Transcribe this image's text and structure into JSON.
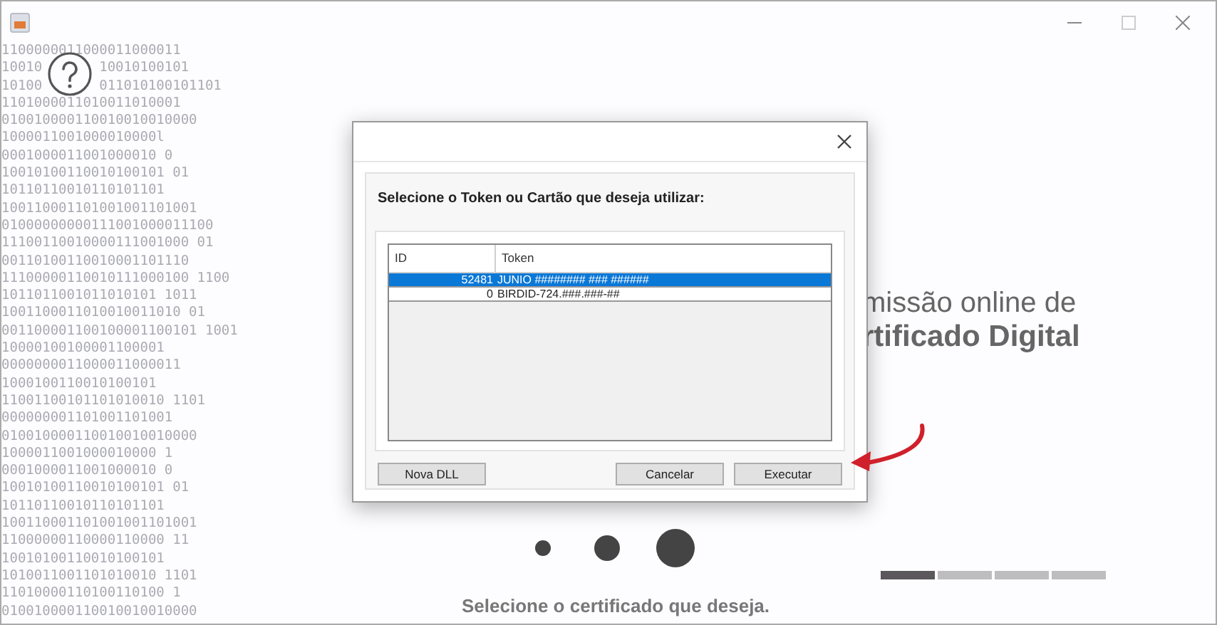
{
  "window": {
    "controls": [
      {
        "kind": "minimize"
      },
      {
        "kind": "maximize"
      },
      {
        "kind": "close"
      }
    ]
  },
  "background_code": [
    "1100000011000011000011",
    [
      "10010",
      "10010100101"
    ],
    [
      "10100",
      "011010100101101"
    ],
    "1101000011010011010001",
    "010010000110010010010000",
    "1000011001000010000l",
    "0001000011001000010 0",
    "10010100110010100101 01",
    "10110110010110101101",
    "100110001101001001101001",
    "01000000000111001000011100",
    "11100110010000111001000 01",
    "00110100110010001101110",
    "11100000110010111000100 1100",
    "1011011001011010101 1011",
    "1001100011010010011010 01",
    "001100001100100001100101 1001",
    "10000100100001100001",
    "0000000011000011000011",
    "1000100110010100101",
    "11001100101101010010 1101",
    "000000001101001101001",
    "010010000110010010010000",
    "1000011001000010000 1",
    "0001000011001000010 0",
    "10010100110010100101 01",
    "10110110010110101101",
    "100110001101001001101001",
    "11000000110000110000 11",
    "10010100110010100101",
    "1010011001101010010 1101",
    "11010000110100110100 1",
    "010010000110010010010000"
  ],
  "main_heading": [
    "missão online de",
    "rtificado Digital"
  ],
  "steps": [
    {
      "selected": true
    },
    {
      "selected": false
    },
    {
      "selected": false
    },
    {
      "selected": false
    }
  ],
  "status_text": "Selecione o certificado que deseja.",
  "dialog": {
    "prompt": "Selecione o Token ou Cartão que deseja utilizar:",
    "table": {
      "columns": [
        "ID",
        "Token"
      ],
      "rows": [
        {
          "id": "52481",
          "token": "JUNIO ######## ### ######",
          "selected": true
        },
        {
          "id": "0",
          "token": "BIRDID-724.###.###-##",
          "selected": false
        }
      ]
    },
    "buttons": [
      "Nova DLL",
      "Cancelar",
      "Executar"
    ]
  }
}
